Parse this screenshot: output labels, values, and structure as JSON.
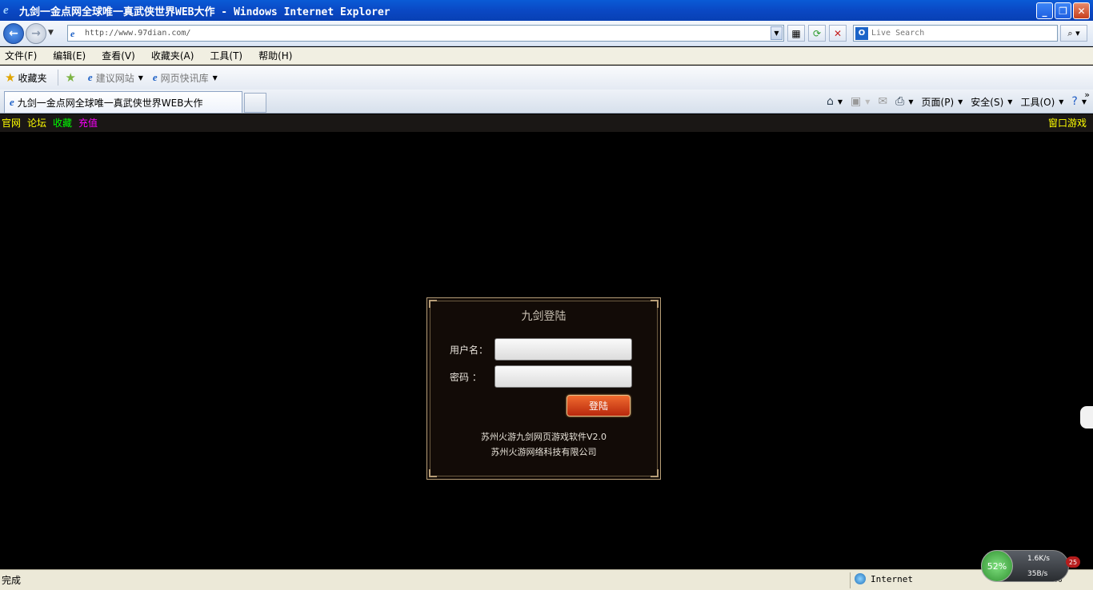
{
  "window": {
    "title": "九剑一金点网全球唯一真武侠世界WEB大作 - Windows Internet Explorer",
    "minimize": "_",
    "maximize": "❐",
    "close": "✕"
  },
  "address": {
    "url": "http://www.97dian.com/",
    "search_placeholder": "Live Search"
  },
  "menu": [
    "文件(F)",
    "编辑(E)",
    "查看(V)",
    "收藏夹(A)",
    "工具(T)",
    "帮助(H)"
  ],
  "favorites": {
    "label": "收藏夹",
    "items": [
      "建议网站",
      "网页快讯库"
    ]
  },
  "tab": {
    "label": "九剑一金点网全球唯一真武侠世界WEB大作"
  },
  "commands": {
    "page": "页面(P)",
    "safety": "安全(S)",
    "tools": "工具(O)"
  },
  "game": {
    "links": [
      {
        "label": "官网",
        "color": "#ffff00"
      },
      {
        "label": "论坛",
        "color": "#ffff00"
      },
      {
        "label": "收藏",
        "color": "#00ff00"
      },
      {
        "label": "充值",
        "color": "#ff00ff"
      }
    ],
    "window_game": "窗口游戏",
    "login": {
      "title": "九剑登陆",
      "username_label": "用户名：",
      "password_label": "密码 ：",
      "button": "登陆",
      "footer1": "苏州火游九剑网页游戏软件V2.0",
      "footer2": "苏州火游网络科技有限公司"
    }
  },
  "status": {
    "text": "完成",
    "zone": "Internet",
    "zoom": "100%"
  },
  "net_widget": {
    "percent": "52%",
    "download": "1.6K/s",
    "upload": "35B/s",
    "badge": "25"
  }
}
